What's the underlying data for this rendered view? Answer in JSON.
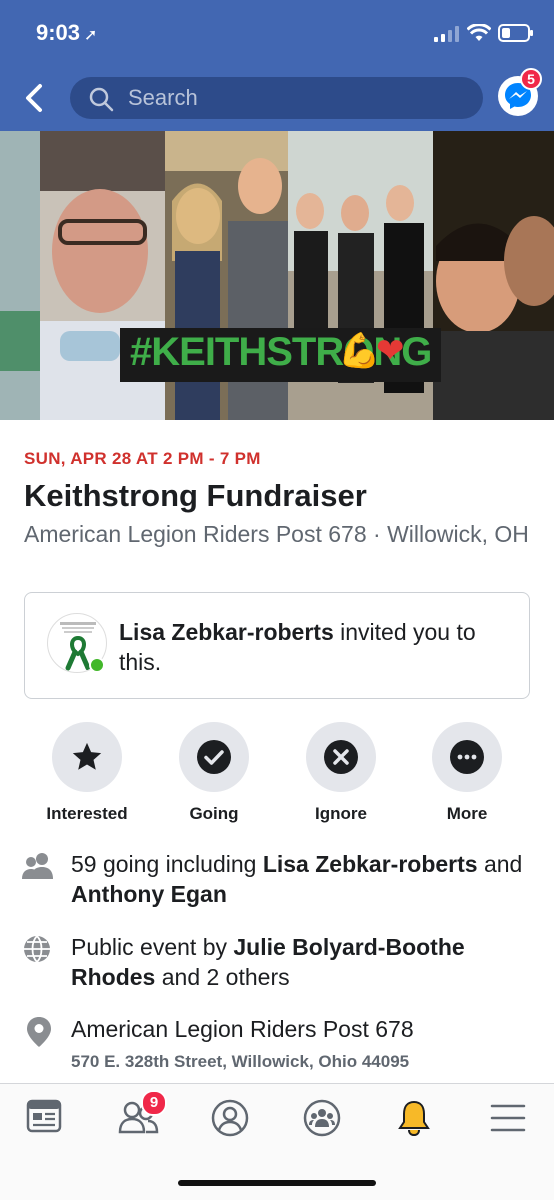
{
  "status_bar": {
    "time": "9:03"
  },
  "search": {
    "placeholder": "Search"
  },
  "messenger": {
    "badge": "5"
  },
  "cover": {
    "hashtag": "#KEITHSTRONG"
  },
  "event": {
    "date": "SUN, APR 28 AT 2 PM - 7 PM",
    "title": "Keithstrong Fundraiser",
    "location_line": "American Legion Riders Post 678 · Willowick, OH"
  },
  "invite": {
    "inviter": "Lisa Zebkar-roberts",
    "message": " invited you to this."
  },
  "actions": [
    {
      "label": "Interested",
      "icon": "star-icon"
    },
    {
      "label": "Going",
      "icon": "check-icon"
    },
    {
      "label": "Ignore",
      "icon": "x-icon"
    },
    {
      "label": "More",
      "icon": "more-icon"
    }
  ],
  "details": {
    "going": {
      "prefix": "59 going including ",
      "name1": "Lisa Zebkar-roberts",
      "and": " and ",
      "name2": "Anthony Egan"
    },
    "host": {
      "prefix": "Public event by ",
      "name": "Julie Bolyard-Boothe Rhodes",
      "suffix": " and 2 others"
    },
    "place": {
      "name": "American Legion Riders Post 678",
      "address": "570 E. 328th Street, Willowick, Ohio 44095"
    }
  },
  "tabbar": {
    "items": [
      "news-feed-icon",
      "friends-icon",
      "profile-icon",
      "groups-icon",
      "notifications-icon",
      "menu-icon"
    ],
    "friends_badge": "9"
  },
  "colors": {
    "brand": "#4267b2",
    "date_red": "#d0312d",
    "badge": "#f02849",
    "bell_active": "#f7b928"
  }
}
